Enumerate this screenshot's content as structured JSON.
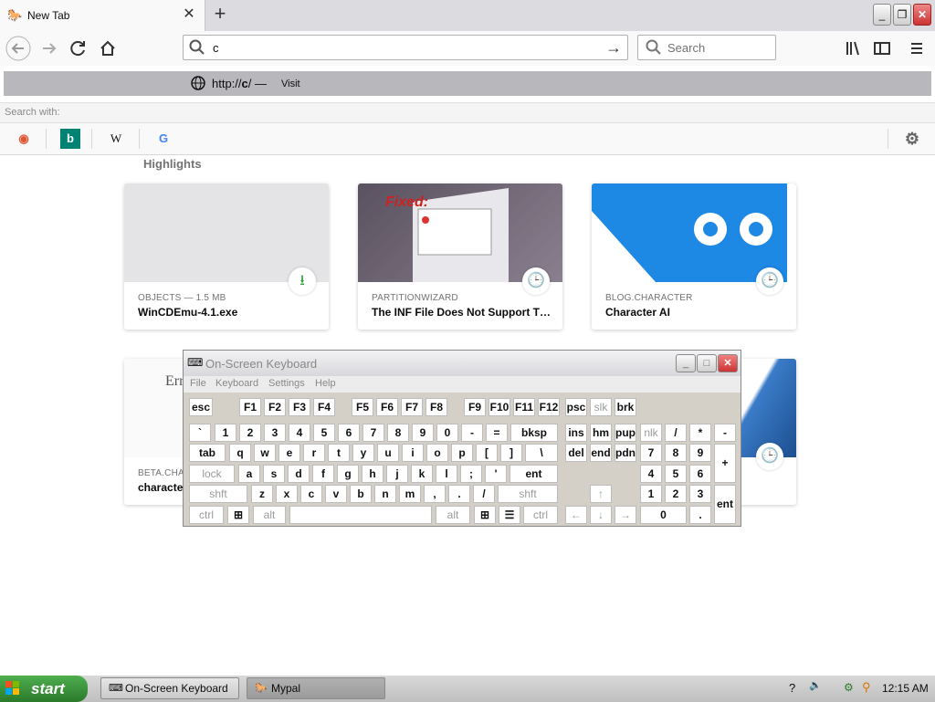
{
  "browser": {
    "tab": {
      "title": "New Tab",
      "icon": "mypal-icon"
    },
    "window_buttons": {
      "minimize": "_",
      "restore": "❐",
      "close": "✕"
    },
    "address_bar": {
      "value": "c"
    },
    "search_bar": {
      "placeholder": "Search"
    },
    "dropdown": {
      "visit_url_prefix": "http://",
      "visit_url_bold": "c",
      "visit_url_suffix": "/",
      "visit_dash": "—",
      "visit_action": "Visit",
      "search_with_label": "Search with:",
      "engines": [
        {
          "name": "duckduckgo-icon",
          "glyph": "◉",
          "color": "#de5833"
        },
        {
          "name": "bing-icon",
          "glyph": "b",
          "color": "#008373"
        },
        {
          "name": "wikipedia-icon",
          "glyph": "W",
          "color": "#000000"
        },
        {
          "name": "google-icon",
          "glyph": "G",
          "color": "#4285f4"
        }
      ]
    }
  },
  "content": {
    "section_title": "Highlights",
    "cards": [
      {
        "source": "OBJECTS — 1.5 MB",
        "title": "WinCDEmu-4.1.exe",
        "badge": "download-icon"
      },
      {
        "source": "PARTITIONWIZARD",
        "title": "The INF File Does Not Support T…",
        "badge": "clock-icon",
        "thumb_text": "Fixed:"
      },
      {
        "source": "BLOG.CHARACTER",
        "title": "Character AI",
        "badge": "clock-icon"
      },
      {
        "source": "BETA.CHA",
        "title": "characte",
        "badge": "clock-icon",
        "thumb_text": "Erro"
      }
    ]
  },
  "osk": {
    "title": "On-Screen Keyboard",
    "menu": [
      "File",
      "Keyboard",
      "Settings",
      "Help"
    ]
  },
  "taskbar": {
    "start_label": "start",
    "tasks": [
      {
        "label": "On-Screen Keyboard",
        "icon": "keyboard-icon"
      },
      {
        "label": "Mypal",
        "icon": "mypal-icon"
      }
    ],
    "clock": "12:15 AM"
  }
}
